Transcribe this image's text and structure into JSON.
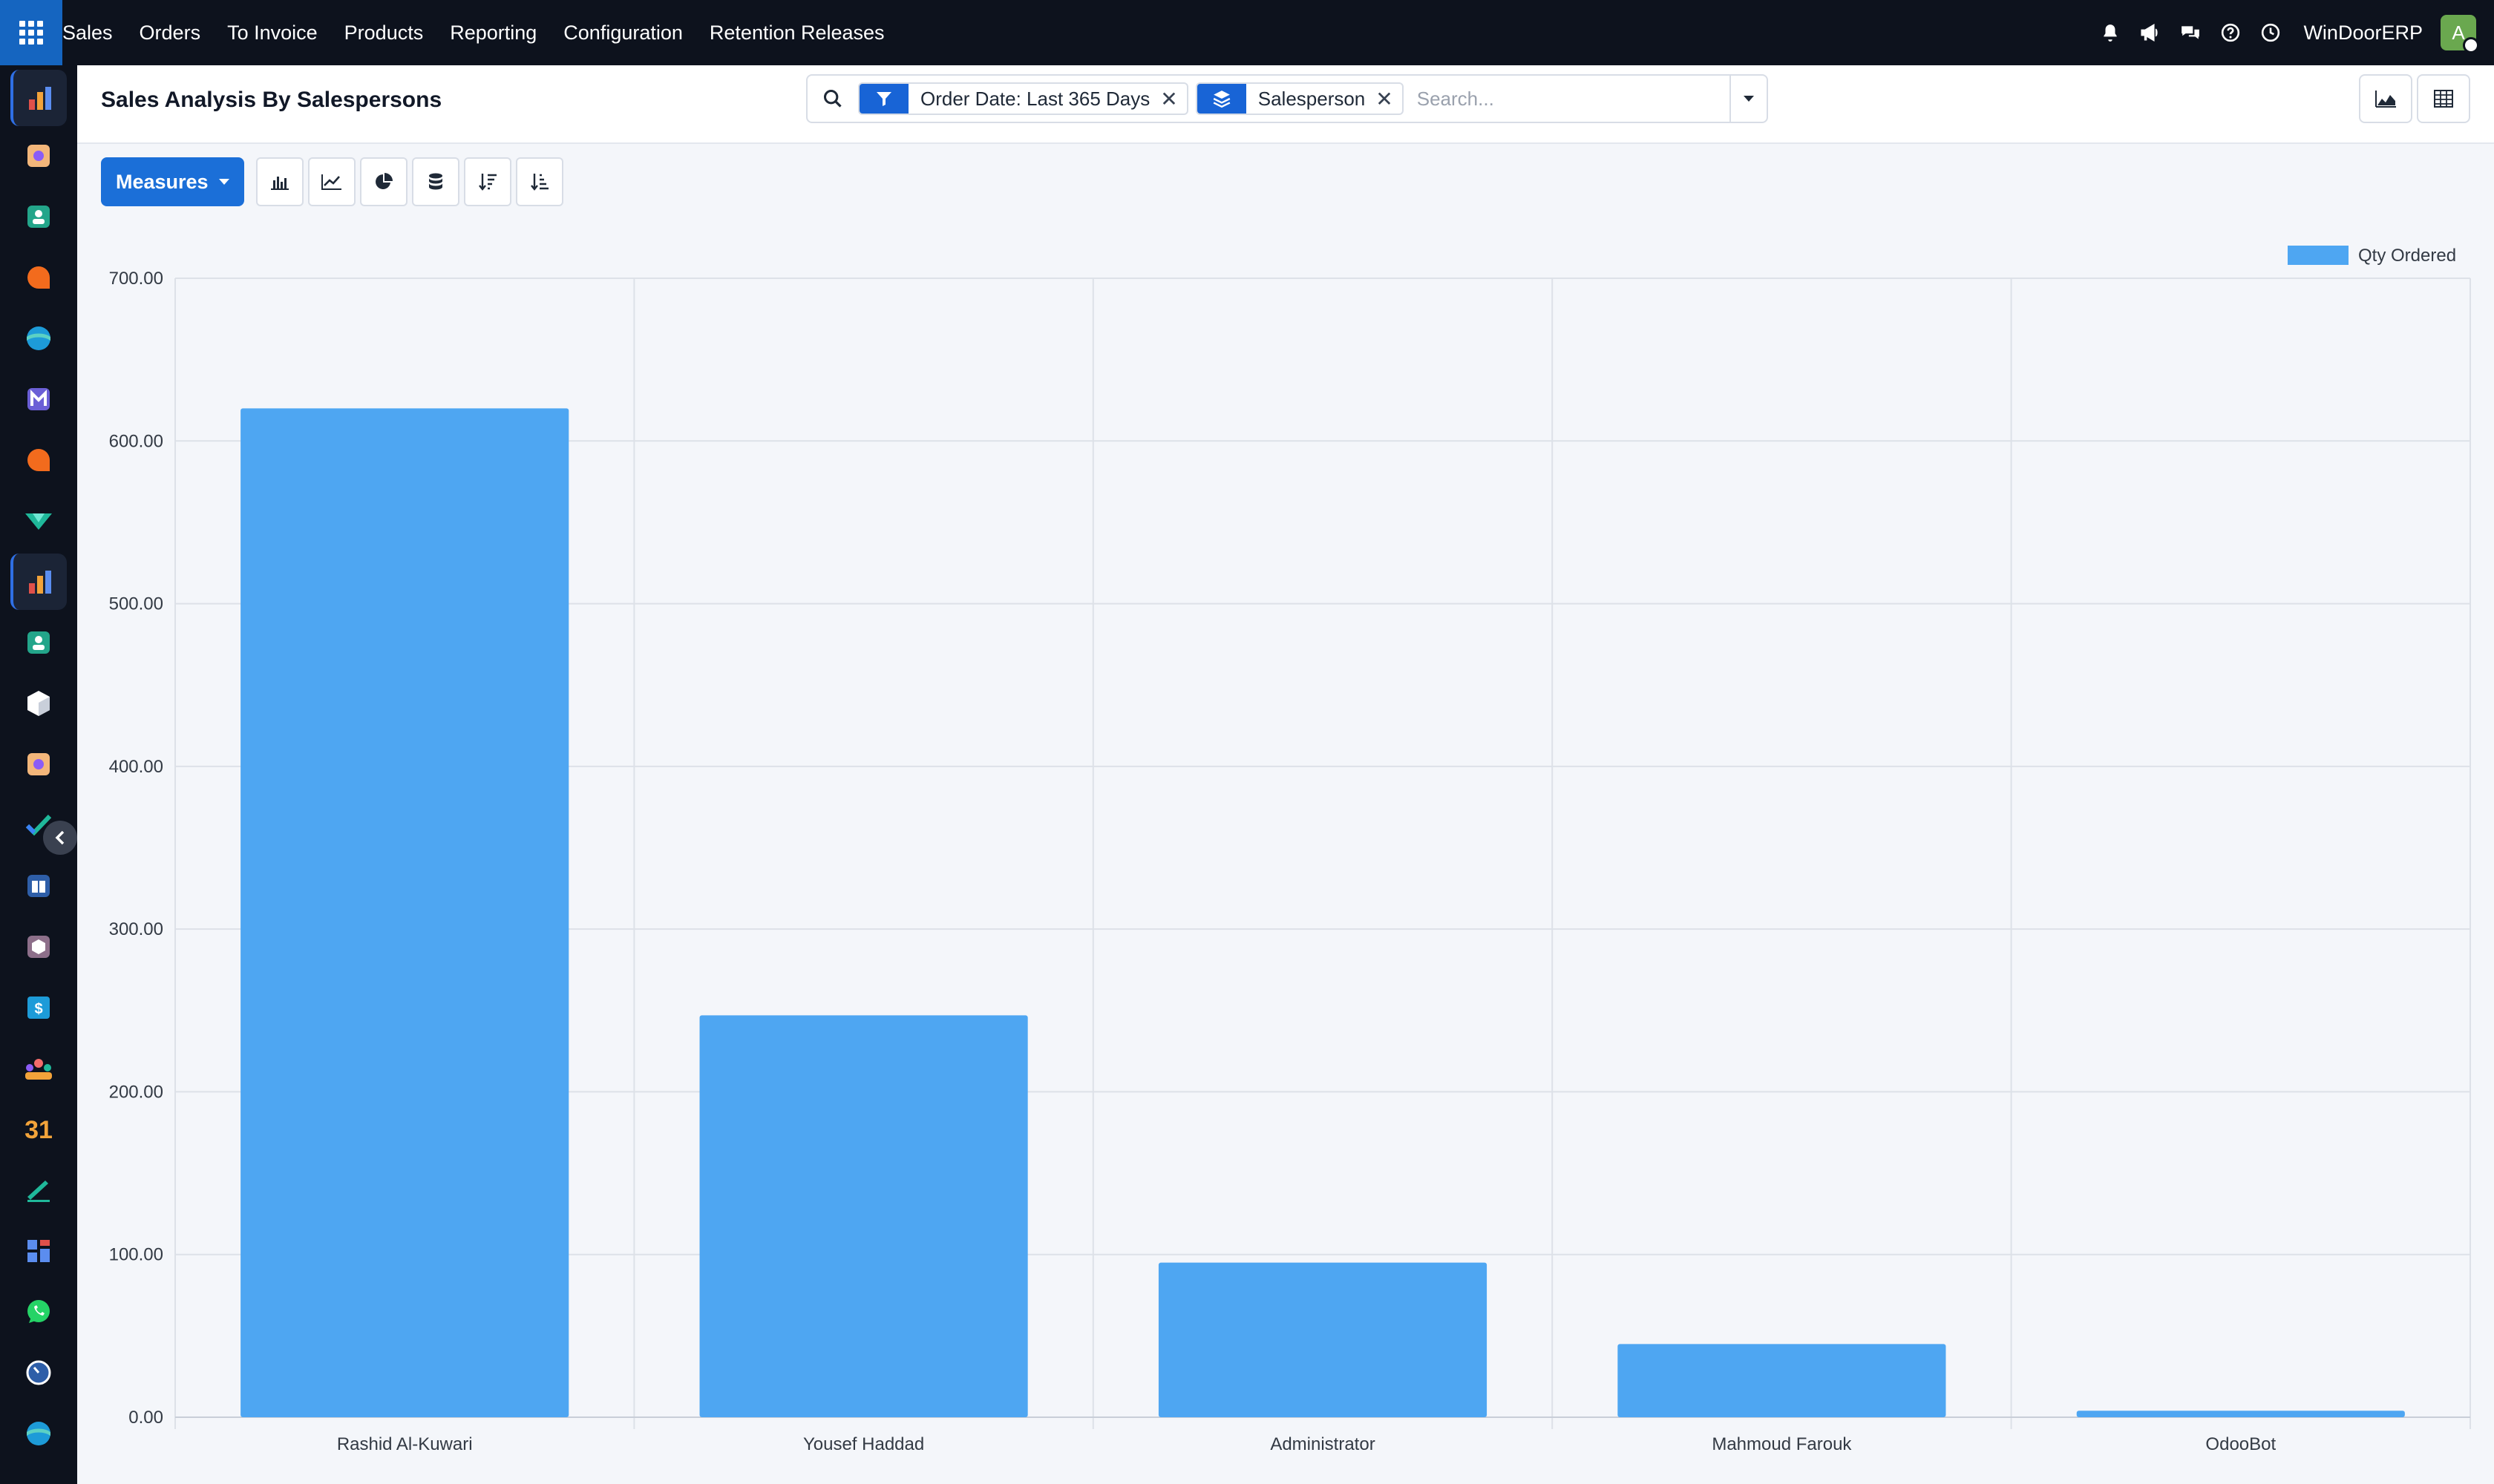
{
  "topbar": {
    "menu": [
      "Sales",
      "Orders",
      "To Invoice",
      "Products",
      "Reporting",
      "Configuration",
      "Retention Releases"
    ],
    "company": "WinDoorERP",
    "avatar_letter": "A"
  },
  "rail": {
    "apps": [
      "sales-app",
      "inventory-app",
      "contacts-app",
      "discuss-app",
      "website-app",
      "email-marketing-app",
      "live-chat-app",
      "project-app",
      "sales-app",
      "employees-app",
      "product-app",
      "inventory-app",
      "todo-app",
      "knowledge-app",
      "manufacturing-app",
      "invoicing-app",
      "recruitment-app",
      "calendar-app",
      "sign-app",
      "dashboards-app",
      "whatsapp-app",
      "timesheets-app",
      "website-app"
    ]
  },
  "control": {
    "title": "Sales Analysis By Salespersons",
    "facets": [
      {
        "icon": "filter-icon",
        "value": "Order Date: Last 365 Days"
      },
      {
        "icon": "group-by-icon",
        "value": "Salesperson"
      }
    ],
    "search_placeholder": "Search..."
  },
  "toolbar": {
    "measures_label": "Measures"
  },
  "chart_data": {
    "type": "bar",
    "categories": [
      "Rashid Al-Kuwari",
      "Yousef Haddad",
      "Administrator",
      "Mahmoud Farouk",
      "OdooBot"
    ],
    "series": [
      {
        "name": "Qty Ordered",
        "values": [
          620,
          247,
          95,
          45,
          4
        ],
        "color": "#4ea6f2"
      }
    ],
    "ylim": [
      0,
      700
    ],
    "yticks": [
      "0.00",
      "100.00",
      "200.00",
      "300.00",
      "400.00",
      "500.00",
      "600.00",
      "700.00"
    ],
    "grid": true,
    "legend_position": "top-right"
  }
}
